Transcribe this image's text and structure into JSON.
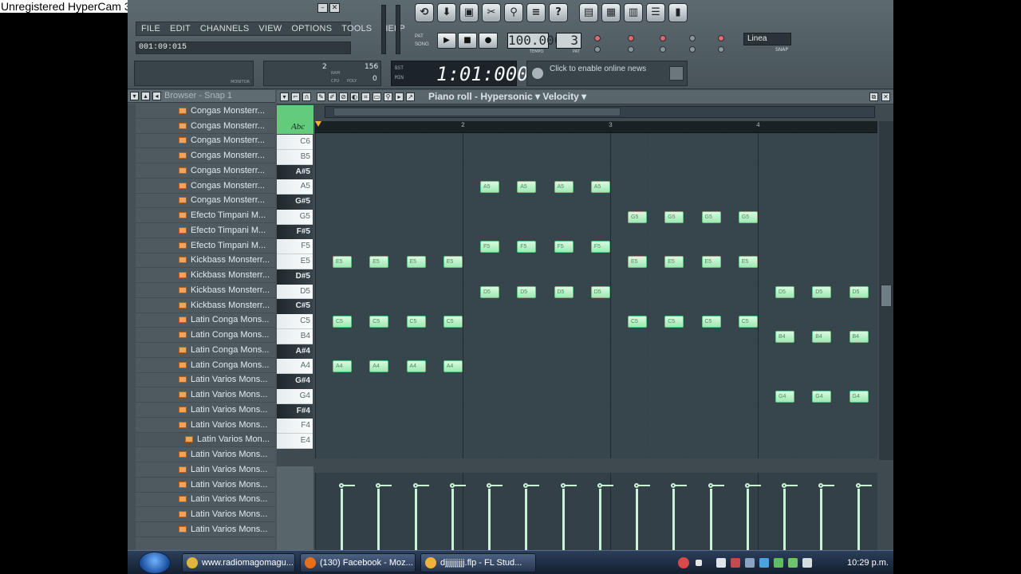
{
  "watermark": "Unregistered HyperCam 3",
  "menu": [
    "FILE",
    "EDIT",
    "CHANNELS",
    "VIEW",
    "OPTIONS",
    "TOOLS",
    "HELP"
  ],
  "hint_time": "001:09:015",
  "monitor": {
    "label1": "MONITOR",
    "cpu_label": "CPU",
    "ram_label": "RAM",
    "poly_label": "POLY",
    "cpu_value": "2",
    "ram_value": "156",
    "poly_value": "0"
  },
  "transport": {
    "pat_label": "PAT",
    "song_label": "SONG",
    "tempo": "100.000",
    "tempo_label": "TEMPO",
    "pattern": "3",
    "pattern_label": "PAT"
  },
  "song_time": "1:01:000",
  "song_time_labels": {
    "bst": "BST",
    "min": "MIN"
  },
  "news": "Click to enable online news",
  "snap_select": {
    "value": "Linea",
    "label": "SNAP"
  },
  "browser": {
    "title": "Browser - Snap 1",
    "items": [
      "Congas Monsterr...",
      "Congas Monsterr...",
      "Congas Monsterr...",
      "Congas Monsterr...",
      "Congas Monsterr...",
      "Congas Monsterr...",
      "Congas Monsterr...",
      "Efecto Timpani M...",
      "Efecto Timpani M...",
      "Efecto Timpani M...",
      "Kickbass Monsterr...",
      "Kickbass Monsterr...",
      "Kickbass Monsterr...",
      "Kickbass Monsterr...",
      "Latin Conga Mons...",
      "Latin Conga Mons...",
      "Latin Conga Mons...",
      "Latin Conga Mons...",
      "Latin Varios Mons...",
      "Latin Varios Mons...",
      "Latin Varios Mons...",
      "Latin Varios Mons...",
      "Latin Varios Mon...",
      "Latin Varios Mons...",
      "Latin Varios Mons...",
      "Latin Varios Mons...",
      "Latin Varios Mons...",
      "Latin Varios Mons...",
      "Latin Varios Mons..."
    ],
    "selected_index": 22
  },
  "pianoroll": {
    "title": "Piano roll - Hypersonic",
    "param": "Velocity",
    "ruler": [
      "2",
      "3",
      "4"
    ],
    "keys": [
      {
        "name": "C6",
        "black": false
      },
      {
        "name": "B5",
        "black": false
      },
      {
        "name": "A#5",
        "black": true
      },
      {
        "name": "A5",
        "black": false
      },
      {
        "name": "G#5",
        "black": true
      },
      {
        "name": "G5",
        "black": false
      },
      {
        "name": "F#5",
        "black": true
      },
      {
        "name": "F5",
        "black": false
      },
      {
        "name": "E5",
        "black": false
      },
      {
        "name": "D#5",
        "black": true
      },
      {
        "name": "D5",
        "black": false
      },
      {
        "name": "C#5",
        "black": true
      },
      {
        "name": "C5",
        "black": false
      },
      {
        "name": "B4",
        "black": false
      },
      {
        "name": "A#4",
        "black": true
      },
      {
        "name": "A4",
        "black": false
      },
      {
        "name": "G#4",
        "black": true
      },
      {
        "name": "G4",
        "black": false
      },
      {
        "name": "F#4",
        "black": true
      },
      {
        "name": "F4",
        "black": false
      },
      {
        "name": "E4",
        "black": false
      }
    ],
    "notes": [
      {
        "label": "E5",
        "row": 8,
        "step": 0
      },
      {
        "label": "E5",
        "row": 8,
        "step": 1
      },
      {
        "label": "E5",
        "row": 8,
        "step": 2
      },
      {
        "label": "E5",
        "row": 8,
        "step": 3
      },
      {
        "label": "C5",
        "row": 12,
        "step": 0
      },
      {
        "label": "C5",
        "row": 12,
        "step": 1
      },
      {
        "label": "C5",
        "row": 12,
        "step": 2
      },
      {
        "label": "C5",
        "row": 12,
        "step": 3
      },
      {
        "label": "A4",
        "row": 15,
        "step": 0
      },
      {
        "label": "A4",
        "row": 15,
        "step": 1
      },
      {
        "label": "A4",
        "row": 15,
        "step": 2
      },
      {
        "label": "A4",
        "row": 15,
        "step": 3
      },
      {
        "label": "A5",
        "row": 3,
        "step": 4
      },
      {
        "label": "A5",
        "row": 3,
        "step": 5
      },
      {
        "label": "A5",
        "row": 3,
        "step": 6
      },
      {
        "label": "A5",
        "row": 3,
        "step": 7
      },
      {
        "label": "F5",
        "row": 7,
        "step": 4
      },
      {
        "label": "F5",
        "row": 7,
        "step": 5
      },
      {
        "label": "F5",
        "row": 7,
        "step": 6
      },
      {
        "label": "F5",
        "row": 7,
        "step": 7
      },
      {
        "label": "D5",
        "row": 10,
        "step": 4
      },
      {
        "label": "D5",
        "row": 10,
        "step": 5
      },
      {
        "label": "D5",
        "row": 10,
        "step": 6
      },
      {
        "label": "D5",
        "row": 10,
        "step": 7
      },
      {
        "label": "G5",
        "row": 5,
        "step": 8
      },
      {
        "label": "G5",
        "row": 5,
        "step": 9
      },
      {
        "label": "G5",
        "row": 5,
        "step": 10
      },
      {
        "label": "G5",
        "row": 5,
        "step": 11
      },
      {
        "label": "E5",
        "row": 8,
        "step": 8
      },
      {
        "label": "E5",
        "row": 8,
        "step": 9
      },
      {
        "label": "E5",
        "row": 8,
        "step": 10
      },
      {
        "label": "E5",
        "row": 8,
        "step": 11
      },
      {
        "label": "C5",
        "row": 12,
        "step": 8
      },
      {
        "label": "C5",
        "row": 12,
        "step": 9
      },
      {
        "label": "C5",
        "row": 12,
        "step": 10
      },
      {
        "label": "C5",
        "row": 12,
        "step": 11
      },
      {
        "label": "D5",
        "row": 10,
        "step": 12
      },
      {
        "label": "D5",
        "row": 10,
        "step": 13
      },
      {
        "label": "D5",
        "row": 10,
        "step": 14
      },
      {
        "label": "B4",
        "row": 13,
        "step": 12
      },
      {
        "label": "B4",
        "row": 13,
        "step": 13
      },
      {
        "label": "B4",
        "row": 13,
        "step": 14
      },
      {
        "label": "G4",
        "row": 17,
        "step": 12
      },
      {
        "label": "G4",
        "row": 17,
        "step": 13
      },
      {
        "label": "G4",
        "row": 17,
        "step": 14
      }
    ],
    "velocity_steps": 15
  },
  "taskbar": {
    "tasks": [
      "www.radiomagomagu...",
      "(130) Facebook - Moz...",
      "djjjjjjjjjj.flp - FL Stud..."
    ],
    "clock": "10:29 p.m."
  },
  "colors": {
    "note_fill": "#b8f0c6",
    "note_border": "#5fbf7e",
    "folder_icon": "#f3a35a"
  }
}
